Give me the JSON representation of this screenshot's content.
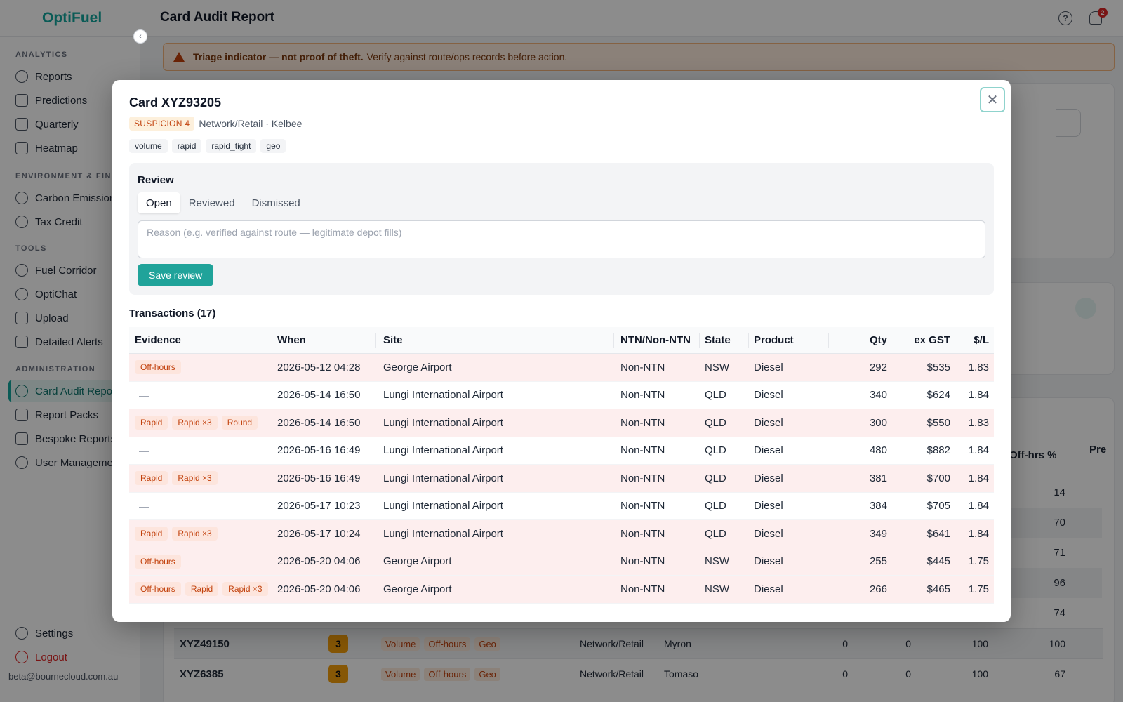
{
  "app": {
    "brand": "OptiFuel",
    "page_title": "Card Audit Report",
    "notification_count": "2",
    "user_email": "beta@bournecloud.com.au"
  },
  "sidebar": {
    "sections": [
      "ANALYTICS",
      "ENVIRONMENT & FINANCE",
      "TOOLS",
      "ADMINISTRATION"
    ],
    "items": [
      "Reports",
      "Predictions",
      "Quarterly",
      "Heatmap",
      "Carbon Emissions",
      "Tax Credit",
      "Fuel Corridor",
      "OptiChat",
      "Upload",
      "Detailed Alerts",
      "Card Audit Report",
      "Report Packs",
      "Bespoke Reports",
      "User Management"
    ],
    "footer": [
      "Settings",
      "Logout"
    ]
  },
  "banner": {
    "bold": "Triage indicator — not proof of theft.",
    "text": "Verify against route/ops records before action."
  },
  "background_table": {
    "headers": {
      "offhrs": "Off-hrs %",
      "pre": "Pre"
    },
    "overflow_values": [
      "14",
      "70",
      "71",
      "96",
      "74"
    ],
    "rows": [
      {
        "card": "XYZ49150",
        "score": "3",
        "tags": [
          "Volume",
          "Off-hours",
          "Geo"
        ],
        "type": "Network/Retail",
        "site": "Myron",
        "v1": "0",
        "v2": "0",
        "v3": "100",
        "v4": "100"
      },
      {
        "card": "XYZ6385",
        "score": "3",
        "tags": [
          "Volume",
          "Off-hours",
          "Geo"
        ],
        "type": "Network/Retail",
        "site": "Tomaso",
        "v1": "0",
        "v2": "0",
        "v3": "100",
        "v4": "67"
      }
    ]
  },
  "modal": {
    "title": "Card XYZ93205",
    "suspicion": "SUSPICION 4",
    "meta": "Network/Retail · Kelbee",
    "flags": [
      "volume",
      "rapid",
      "rapid_tight",
      "geo"
    ],
    "review": {
      "title": "Review",
      "tabs": [
        "Open",
        "Reviewed",
        "Dismissed"
      ],
      "active_tab": "Open",
      "placeholder": "Reason (e.g. verified against route — legitimate depot fills)",
      "save_label": "Save review"
    },
    "transactions": {
      "title": "Transactions (17)",
      "columns": {
        "evidence": "Evidence",
        "when": "When",
        "site": "Site",
        "ntn": "NTN/Non-NTN",
        "state": "State",
        "product": "Product",
        "qty": "Qty",
        "gst": "ex GST",
        "sl": "$/L"
      },
      "none_marker": "—",
      "rows": [
        {
          "evidence": [
            "Off-hours"
          ],
          "when": "2026-05-12 04:28",
          "site": "George Airport",
          "ntn": "Non-NTN",
          "state": "NSW",
          "product": "Diesel",
          "qty": "292",
          "gst": "$535",
          "sl": "1.83"
        },
        {
          "evidence": [],
          "when": "2026-05-14 16:50",
          "site": "Lungi International Airport",
          "ntn": "Non-NTN",
          "state": "QLD",
          "product": "Diesel",
          "qty": "340",
          "gst": "$624",
          "sl": "1.84"
        },
        {
          "evidence": [
            "Rapid",
            "Rapid ×3",
            "Round"
          ],
          "when": "2026-05-14 16:50",
          "site": "Lungi International Airport",
          "ntn": "Non-NTN",
          "state": "QLD",
          "product": "Diesel",
          "qty": "300",
          "gst": "$550",
          "sl": "1.83"
        },
        {
          "evidence": [],
          "when": "2026-05-16 16:49",
          "site": "Lungi International Airport",
          "ntn": "Non-NTN",
          "state": "QLD",
          "product": "Diesel",
          "qty": "480",
          "gst": "$882",
          "sl": "1.84"
        },
        {
          "evidence": [
            "Rapid",
            "Rapid ×3"
          ],
          "when": "2026-05-16 16:49",
          "site": "Lungi International Airport",
          "ntn": "Non-NTN",
          "state": "QLD",
          "product": "Diesel",
          "qty": "381",
          "gst": "$700",
          "sl": "1.84"
        },
        {
          "evidence": [],
          "when": "2026-05-17 10:23",
          "site": "Lungi International Airport",
          "ntn": "Non-NTN",
          "state": "QLD",
          "product": "Diesel",
          "qty": "384",
          "gst": "$705",
          "sl": "1.84"
        },
        {
          "evidence": [
            "Rapid",
            "Rapid ×3"
          ],
          "when": "2026-05-17 10:24",
          "site": "Lungi International Airport",
          "ntn": "Non-NTN",
          "state": "QLD",
          "product": "Diesel",
          "qty": "349",
          "gst": "$641",
          "sl": "1.84"
        },
        {
          "evidence": [
            "Off-hours"
          ],
          "when": "2026-05-20 04:06",
          "site": "George Airport",
          "ntn": "Non-NTN",
          "state": "NSW",
          "product": "Diesel",
          "qty": "255",
          "gst": "$445",
          "sl": "1.75"
        },
        {
          "evidence": [
            "Off-hours",
            "Rapid",
            "Rapid ×3"
          ],
          "when": "2026-05-20 04:06",
          "site": "George Airport",
          "ntn": "Non-NTN",
          "state": "NSW",
          "product": "Diesel",
          "qty": "266",
          "gst": "$465",
          "sl": "1.75"
        }
      ]
    }
  },
  "colors": {
    "accent": "#13a69d",
    "flag_bg": "#fdeeee",
    "flag_text": "#c2410c",
    "warning_bg": "#fdecdc"
  }
}
